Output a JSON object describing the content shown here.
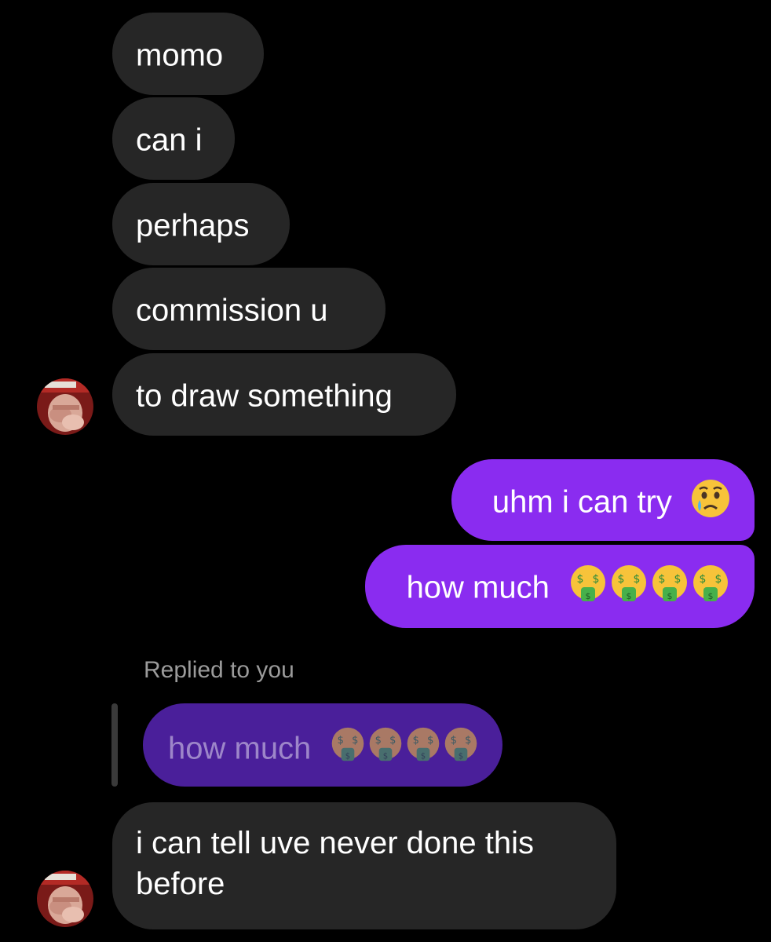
{
  "thread": {
    "messages_in_top": [
      {
        "text": "momo"
      },
      {
        "text": "can i"
      },
      {
        "text": "perhaps"
      },
      {
        "text": "commission u"
      },
      {
        "text": "to draw something"
      }
    ],
    "outgoing": [
      {
        "text": "uhm i can try",
        "emoji": "crying-face-emoji"
      },
      {
        "text": "how much",
        "emoji": "money-mouth-face-emoji x4"
      }
    ],
    "reply": {
      "label": "Replied to you",
      "quoted_text": "how much",
      "quoted_emoji": "money-mouth-face-emoji x4"
    },
    "last_incoming": {
      "line1": "i can tell uve never done this",
      "line2": "before"
    }
  },
  "colors": {
    "incoming_bubble": "#262626",
    "outgoing_bubble": "#8a2cf0",
    "quoted_bubble": "#4a1f9a",
    "background": "#000000"
  }
}
